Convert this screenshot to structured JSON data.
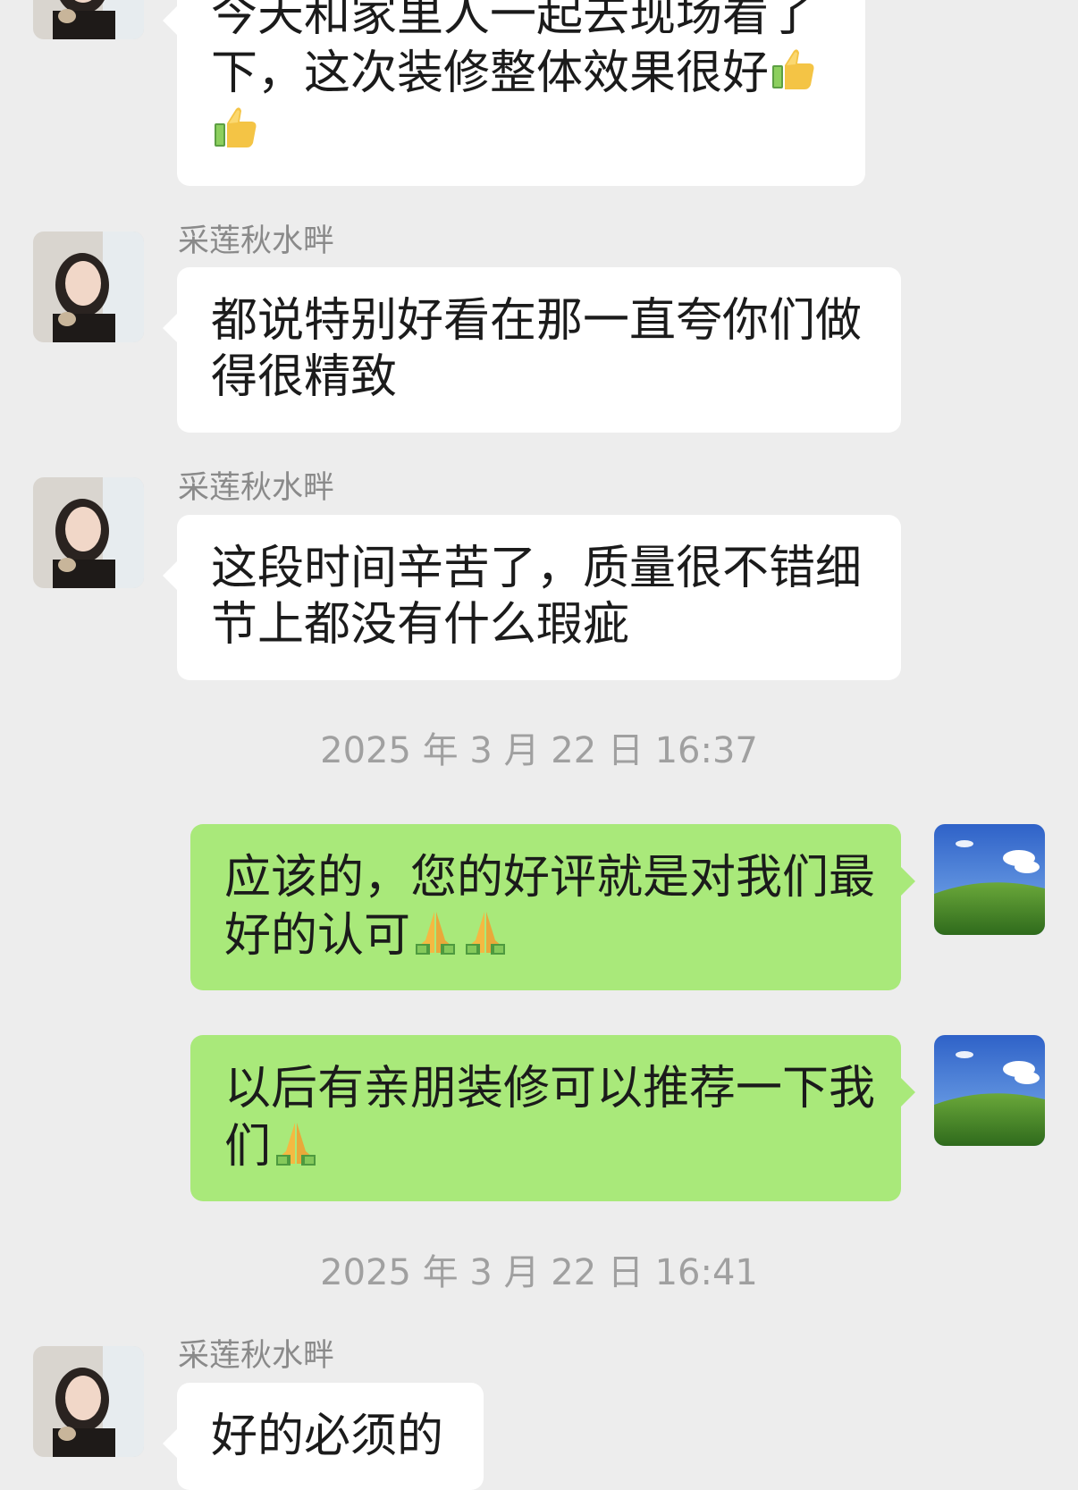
{
  "messages": [
    {
      "sender": "",
      "lines": [
        "今天和家里人一起去现场看了",
        "下，这次装修整体效果很好",
        ""
      ],
      "emoji": "thumbs-up"
    },
    {
      "sender": "采莲秋水畔",
      "lines": [
        "都说特别好看在那一直夸你们做",
        "得很精致"
      ]
    },
    {
      "sender": "采莲秋水畔",
      "lines": [
        "这段时间辛苦了，质量很不错细",
        "节上都没有什么瑕疵"
      ]
    },
    {
      "timestamp": "2025 年 3 月 22 日 16:37"
    },
    {
      "lines": [
        "应该的，您的好评就是对我们最",
        "好的认可"
      ],
      "emoji": "folded-hands"
    },
    {
      "lines": [
        "以后有亲朋装修可以推荐一下我",
        "们"
      ],
      "emoji": "folded-hands"
    },
    {
      "timestamp": "2025 年 3 月 22 日 16:41"
    },
    {
      "sender": "采莲秋水畔",
      "lines": [
        "好的必须的"
      ]
    }
  ],
  "colors": {
    "background": "#ededed",
    "incoming_bubble": "#ffffff",
    "outgoing_bubble": "#a9e97a",
    "sender_name": "#8a8a8a",
    "timestamp": "#a0a0a0"
  }
}
